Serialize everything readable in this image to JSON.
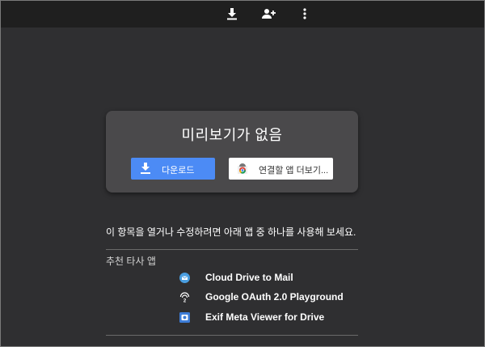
{
  "toolbar": {
    "icons": [
      "download-icon",
      "person-add-icon",
      "more-vert-icon"
    ]
  },
  "preview": {
    "title": "미리보기가 없음",
    "download_label": "다운로드",
    "more_apps_label": "연결할 앱 더보기..."
  },
  "description": "이 항목을 열거나 수정하려면 아래 앱 중 하나를 사용해 보세요.",
  "recommended": {
    "label": "추천 타사 앱",
    "apps": [
      {
        "name": "Cloud Drive to Mail",
        "icon": "mail-app-icon"
      },
      {
        "name": "Google OAuth 2.0 Playground",
        "icon": "oauth-playground-icon"
      },
      {
        "name": "Exif Meta Viewer for Drive",
        "icon": "exif-viewer-icon"
      }
    ]
  },
  "colors": {
    "background": "#2f2f31",
    "topbar": "#1f1f1f",
    "card": "#4a494b",
    "download_button": "#4c8bf5"
  }
}
